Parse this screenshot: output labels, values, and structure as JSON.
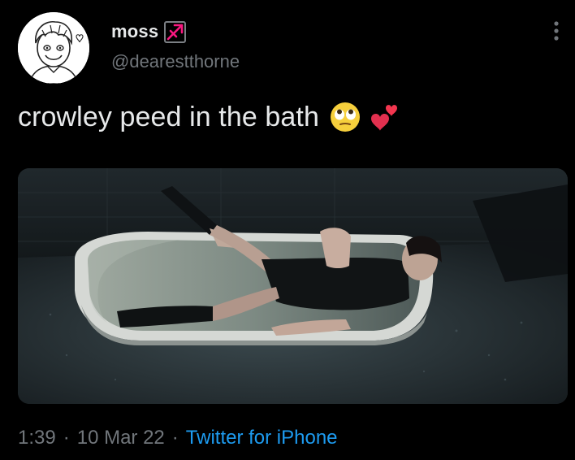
{
  "author": {
    "display_name": "moss",
    "handle": "@dearestthorne",
    "avatar_icon": "cartoon-avatar-icon",
    "badge_icon": "sagittarius-icon"
  },
  "tweet": {
    "text": "crowley peed in the bath",
    "emojis": [
      "face-with-rolling-eyes-icon",
      "two-hearts-icon"
    ],
    "media_alt_icon": "bathtub-photo"
  },
  "meta": {
    "time": "1:39",
    "date": "10 Mar 22",
    "separator": "·",
    "source": "Twitter for iPhone"
  },
  "colors": {
    "background": "#000000",
    "text_primary": "#e7e9ea",
    "text_secondary": "#71767b",
    "link": "#1d9bf0",
    "zodiac": "#f91880"
  }
}
